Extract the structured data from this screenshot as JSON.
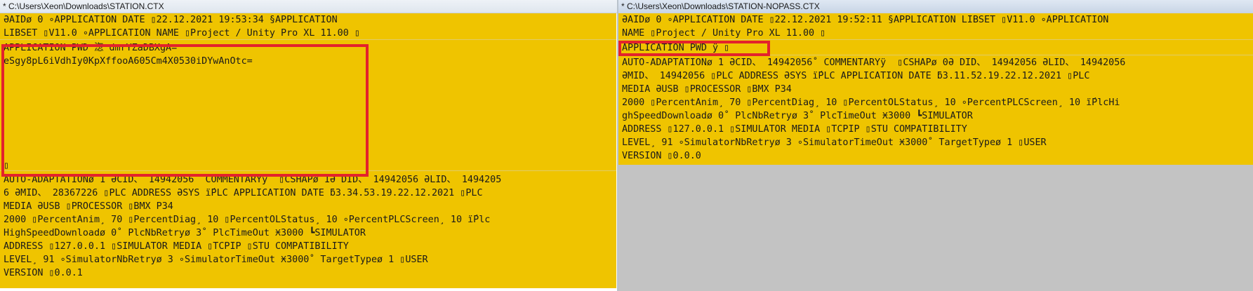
{
  "left": {
    "title": "* C:\\Users\\Xeon\\Downloads\\STATION.CTX",
    "lines": [
      "ƏAIDø 0 ∘APPLICATION DATE ▯22.12.2021 19:53:34 §APPLICATION",
      "LIBSET ▯V11.0 ∘APPLICATION NAME ▯Project / Unity Pro XL 11.00 ▯",
      "APPLICATION PWD 淴 dmrYZaDBXgA=",
      "eSgy8pL6iVdhIy0KpXffooA605Cm4X0530iDYwAnOtc=",
      "▯",
      "AUTO-ADAPTATIONø 1 ƏCID、 14942056˚ COMMENTARYÿ  ▯CSHAPø 1Ə DID、 14942056 ƏLID、 1494205",
      "6 ƏMID、 28367226 ▯PLC ADDRESS ƏSYS ḯPLC APPLICATION DATE ƃ3.34.53.19.22.12.2021 ▯PLC",
      "MEDIA ƏUSB ▯PROCESSOR ▯BMX P34",
      "2000 ▯PercentAnim¸ 70 ▯PercentDiag¸ 10 ▯PercentOLStatus¸ 10 ∘PercentPLCScreen¸ 10 ḯPlc",
      "HighSpeedDownloadø 0˚ PlcNbRetryø 3˚ PlcTimeOut Ӿ3000 ┗SIMULATOR",
      "ADDRESS ▯127.0.0.1 ▯SIMULATOR MEDIA ▯TCPIP ▯STU COMPATIBILITY",
      "LEVEL¸ 91 ∘SimulatorNbRetryø 3 ∘SimulatorTimeOut Ӿ3000˚ TargetTypeø 1 ▯USER",
      "VERSION ▯0.0.1"
    ]
  },
  "right": {
    "title": "* C:\\Users\\Xeon\\Downloads\\STATION-NOPASS.CTX",
    "lines": [
      "ƏAIDø 0 ∘APPLICATION DATE ▯22.12.2021 19:52:11 §APPLICATION LIBSET ▯V11.0 ∘APPLICATION",
      "NAME ▯Project / Unity Pro XL 11.00 ▯",
      "APPLICATION PWD ÿ ▯",
      "AUTO-ADAPTATIONø 1 ƏCID、 14942056˚ COMMENTARYÿ  ▯CSHAPø 0Ə DID、 14942056 ƏLID、 14942056",
      "ƏMID、 14942056 ▯PLC ADDRESS ƏSYS ḯPLC APPLICATION DATE ƃ3.11.52.19.22.12.2021 ▯PLC",
      "MEDIA ƏUSB ▯PROCESSOR ▯BMX P34",
      "2000 ▯PercentAnim¸ 70 ▯PercentDiag¸ 10 ▯PercentOLStatus¸ 10 ∘PercentPLCScreen¸ 10 ḯPlcHi",
      "ghSpeedDownloadø 0˚ PlcNbRetryø 3˚ PlcTimeOut Ӿ3000 ┗SIMULATOR",
      "ADDRESS ▯127.0.0.1 ▯SIMULATOR MEDIA ▯TCPIP ▯STU COMPATIBILITY",
      "LEVEL¸ 91 ∘SimulatorNbRetryø 3 ∘SimulatorTimeOut Ӿ3000˚ TargetTypeø 1 ▯USER",
      "VERSION ▯0.0.0"
    ]
  },
  "colors": {
    "text_background": "#efc400",
    "highlight": "#f4e6b5",
    "annotation_box": "#e3222c",
    "empty_area": "#c3c3c3"
  }
}
